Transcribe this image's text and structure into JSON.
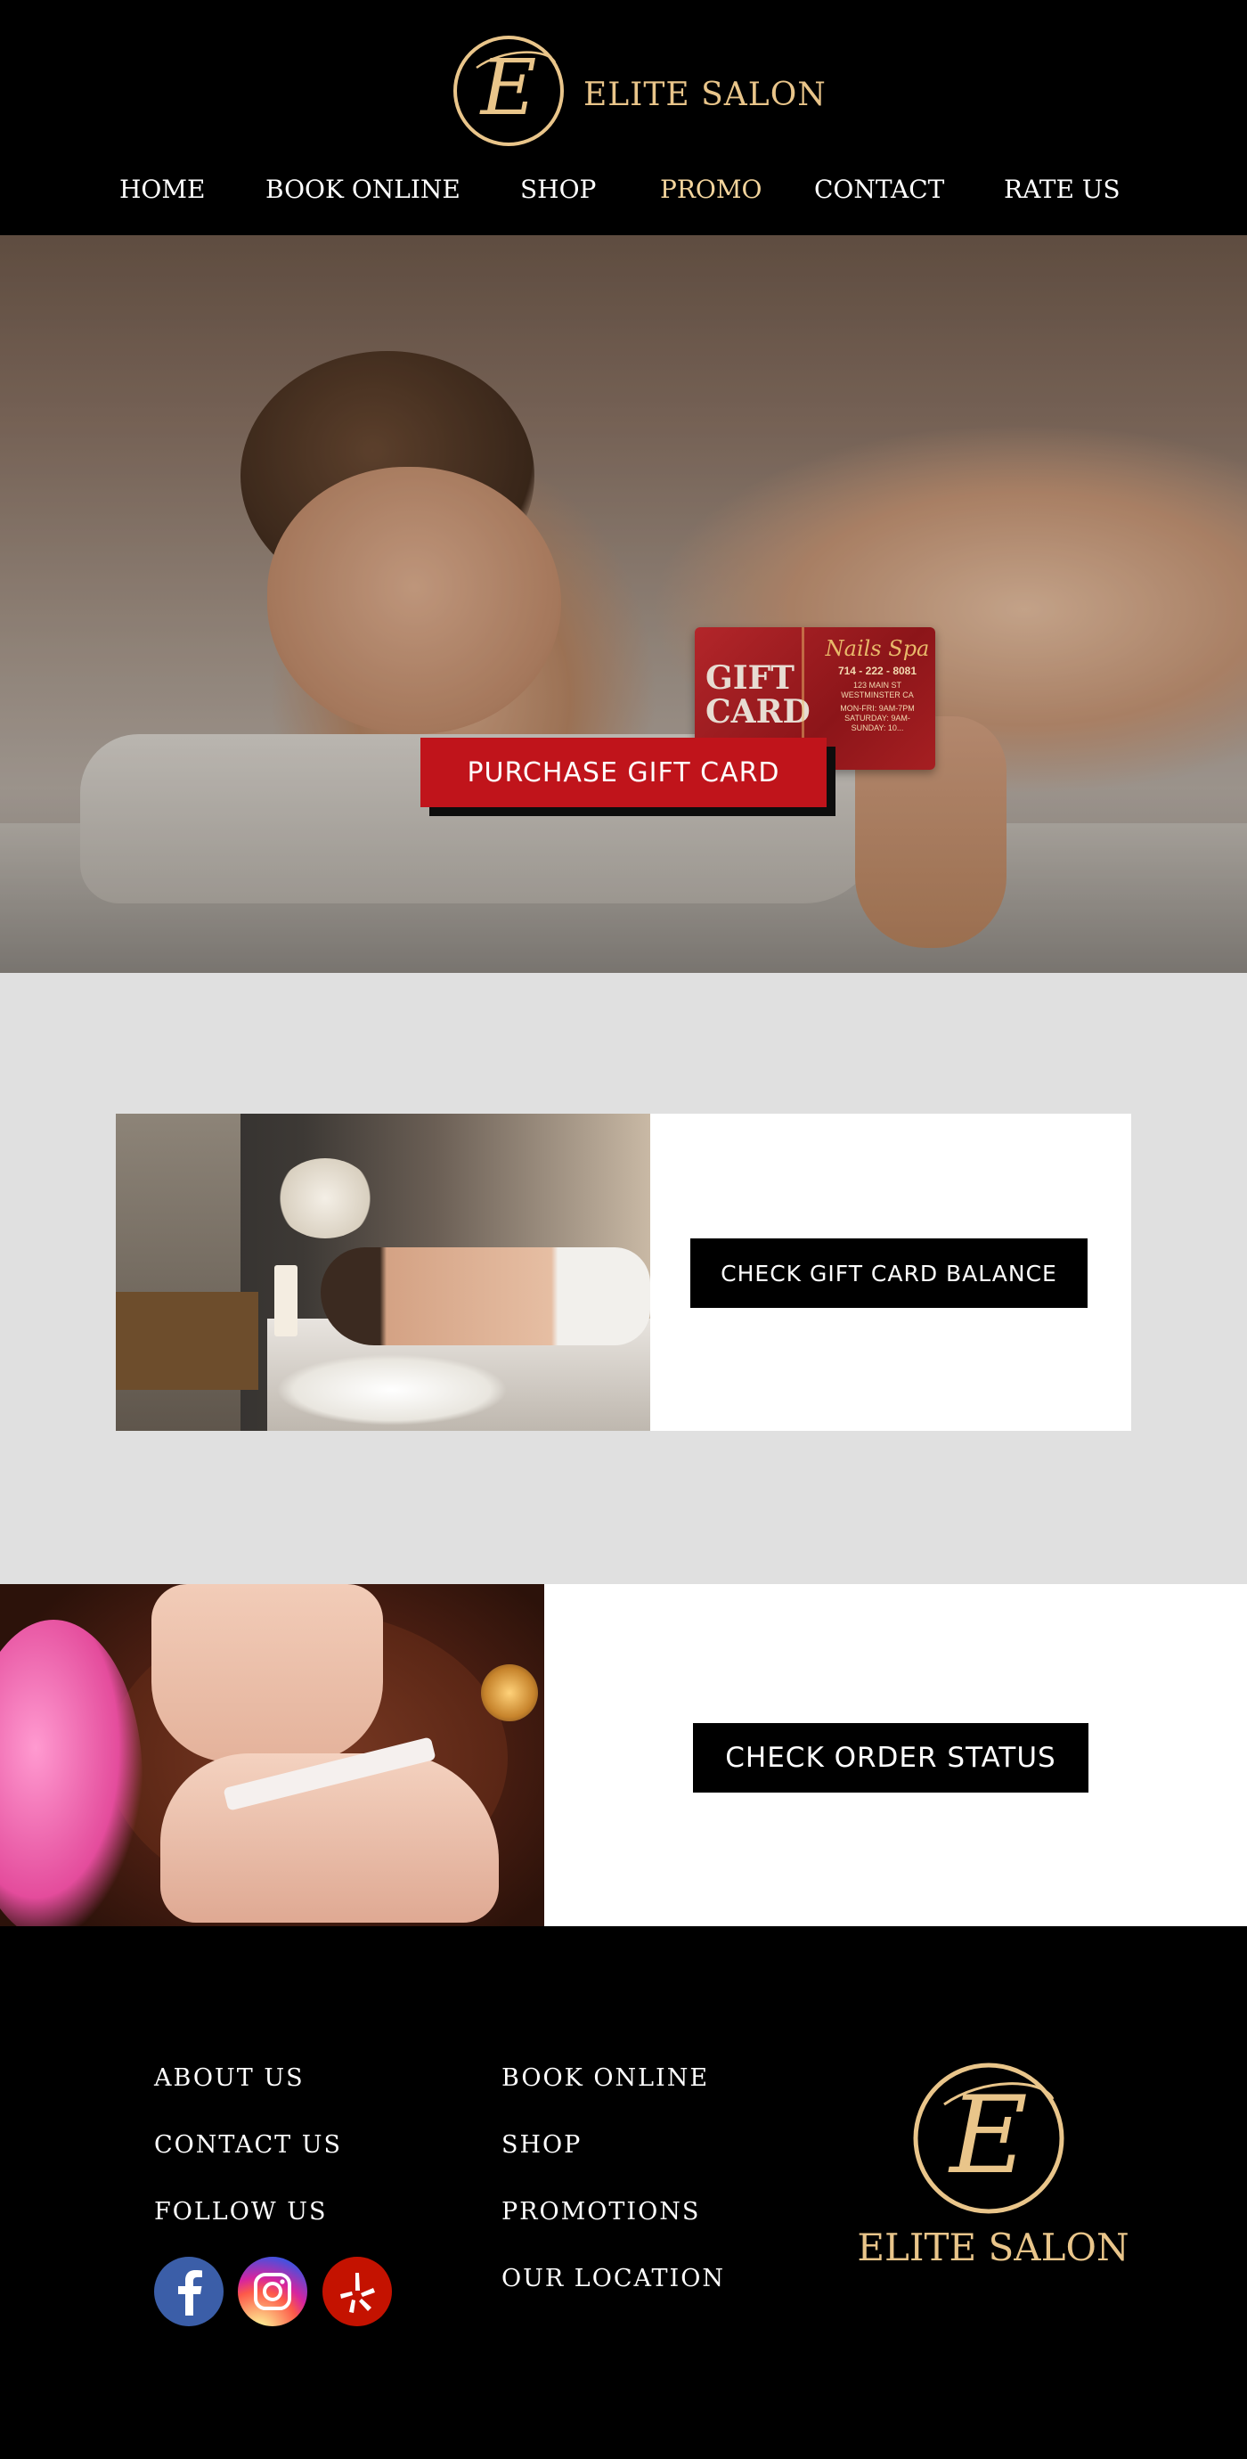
{
  "brand": {
    "name": "ELITE SALON",
    "monogram": "E",
    "accent_color": "#e9c58a"
  },
  "nav": {
    "items": [
      {
        "label": "HOME"
      },
      {
        "label": "BOOK ONLINE"
      },
      {
        "label": "SHOP"
      },
      {
        "label": "PROMO",
        "active": true
      },
      {
        "label": "CONTACT"
      },
      {
        "label": "RATE US"
      }
    ]
  },
  "hero": {
    "cta_label": "PURCHASE GIFT CARD",
    "cta_color": "#c0141b",
    "gift_card": {
      "title_line1": "GIFT",
      "title_line2": "CARD",
      "brand": "Nails Spa",
      "phone": "714 - 222 - 8081",
      "address_line1": "123 MAIN ST",
      "address_line2": "WESTMINSTER CA",
      "hours_line1": "MON-FRI: 9AM-7PM",
      "hours_line2": "SATURDAY: 9AM-",
      "hours_line3": "SUNDAY: 10..."
    },
    "slider": {
      "count": 4,
      "active_index": 0
    }
  },
  "balance_section": {
    "button_label": "CHECK GIFT CARD BALANCE"
  },
  "order_section": {
    "button_label": "CHECK ORDER STATUS"
  },
  "footer": {
    "col1": [
      "ABOUT US",
      "CONTACT US",
      "FOLLOW US"
    ],
    "col2": [
      "BOOK ONLINE",
      "SHOP",
      "PROMOTIONS",
      "OUR LOCATION"
    ],
    "social": [
      {
        "name": "facebook-icon",
        "glyph": "f"
      },
      {
        "name": "instagram-icon",
        "glyph": "◎"
      },
      {
        "name": "yelp-icon",
        "glyph": "✻"
      }
    ],
    "logo_text": "ELITE SALON"
  }
}
